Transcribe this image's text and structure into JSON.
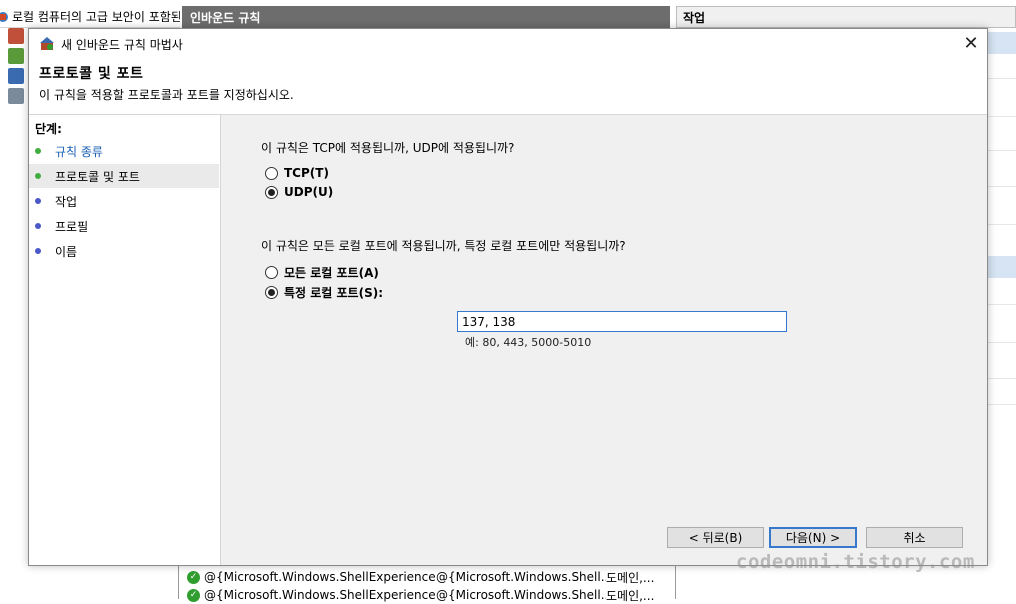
{
  "background": {
    "tree_header": "로컬 컴퓨터의 고급 보안이 포함된",
    "middle_header": "인바운드 규칙",
    "actions_header": "작업",
    "rows": [
      {
        "name": "@{Microsoft.Windows.ShellExperienceH...",
        "group": "@{Microsoft.Windows.Shell...",
        "profile": "도메인,..."
      },
      {
        "name": "@{Microsoft.Windows.ShellExperienceH...",
        "group": "@{Microsoft.Windows.Shell...",
        "profile": "도메인,..."
      }
    ]
  },
  "dialog": {
    "title": "새 인바운드 규칙 마법사",
    "close_glyph": "✕",
    "heading": "프로토콜 및 포트",
    "subheading": "이 규칙을 적용할 프로토콜과 포트를 지정하십시오.",
    "steps_label": "단계:",
    "steps": [
      {
        "label": "규칙 종류"
      },
      {
        "label": "프로토콜 및 포트"
      },
      {
        "label": "작업"
      },
      {
        "label": "프로필"
      },
      {
        "label": "이름"
      }
    ],
    "protocol_question": "이 규칙은 TCP에 적용됩니까, UDP에 적용됩니까?",
    "protocol_options": {
      "tcp": "TCP(T)",
      "udp": "UDP(U)",
      "selected": "udp"
    },
    "port_question": "이 규칙은 모든 로컬 포트에 적용됩니까, 특정 로컬 포트에만 적용됩니까?",
    "port_options": {
      "all": "모든 로컬 포트(A)",
      "specific": "특정 로컬 포트(S):",
      "selected": "specific"
    },
    "port_value": "137, 138",
    "port_example": "예: 80, 443, 5000-5010",
    "buttons": {
      "back": "< 뒤로(B)",
      "next": "다음(N) >",
      "cancel": "취소"
    }
  },
  "watermark": "codeomni.tistory.com",
  "colors": {
    "accent": "#3778cf",
    "step_done": "#3fae3f",
    "step_todo": "#4b58c8",
    "step_done_text": "#1a5fb4"
  }
}
